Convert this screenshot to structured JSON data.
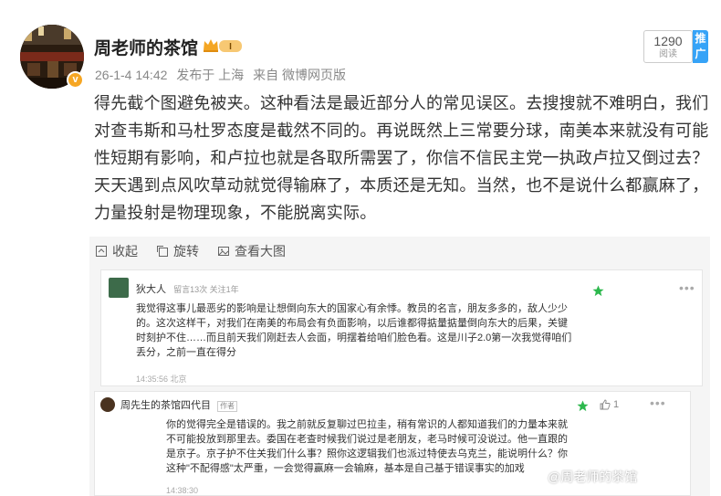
{
  "post": {
    "author_name": "周老师的茶馆",
    "level_badge": "I",
    "timestamp": "26-1-4 14:42",
    "location": "发布于 上海",
    "source": "来自 微博网页版",
    "read_count": "1290",
    "read_label": "阅读",
    "push_label": "推广",
    "content": "得先截个图避免被夹。这种看法是最近部分人的常见误区。去搜搜就不难明白，我们对查韦斯和马杜罗态度是截然不同的。再说既然上三常要分球，南美本来就没有可能性短期有影响，和卢拉也就是各取所需罢了，你信不信民主党一执政卢拉又倒过去？天天遇到点风吹草动就觉得输麻了，本质还是无知。当然，也不是说什么都赢麻了，力量投射是物理现象，不能脱离实际。"
  },
  "toolbar": {
    "collapse_label": "收起",
    "rotate_label": "旋转",
    "view_large_label": "查看大图"
  },
  "screenshot": {
    "comment1": {
      "name": "狄大人",
      "stats": "留言13次 关注1年",
      "text": "我觉得这事儿最恶劣的影响是让想倒向东大的国家心有余悸。教员的名言，朋友多多的，敌人少少的。这次这样干，对我们在南美的布局会有负面影响，以后谁都得掂量掂量倒向东大的后果，关键时刻护不住……而且前天我们刚赶去人会面，明摆着给咱们脸色看。这是川子2.0第一次我觉得咱们丢分，之前一直在得分",
      "time": "14:35:56 北京"
    },
    "comment2": {
      "name": "周先生的茶馆四代目",
      "author_tag": "作者",
      "likes": "1",
      "text": "你的觉得完全是错误的。我之前就反复聊过巴拉圭，稍有常识的人都知道我们的力量本来就不可能投放到那里去。委国在老查时候我们说过是老朋友，老马时候可没说过。他一直跟的是京子。京子护不住关我们什么事？照你这逻辑我们也派过特使去乌克兰，能说明什么？你这种\"不配得感\"太严重，一会觉得赢麻一会输麻，基本是自己基于错误事实的加戏",
      "time": "14:38:30"
    },
    "watermark": "@周老师的茶馆"
  },
  "colors": {
    "accent_blue": "#36a3f7",
    "badge_orange": "#f6a623",
    "star_green": "#2db84d"
  }
}
